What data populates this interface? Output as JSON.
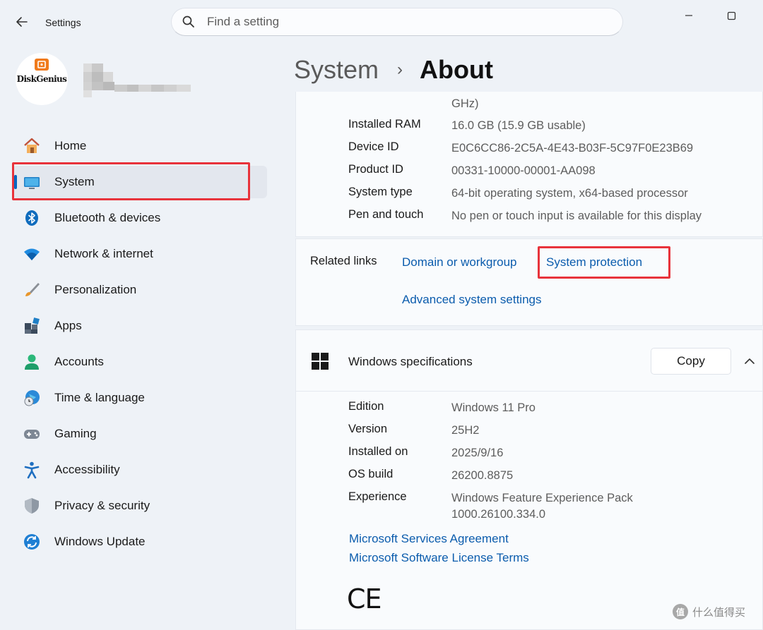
{
  "window": {
    "title": "Settings"
  },
  "search": {
    "placeholder": "Find a setting"
  },
  "profile": {
    "avatar_text": "DiskGenius"
  },
  "sidebar": {
    "items": [
      {
        "label": "Home"
      },
      {
        "label": "System"
      },
      {
        "label": "Bluetooth & devices"
      },
      {
        "label": "Network & internet"
      },
      {
        "label": "Personalization"
      },
      {
        "label": "Apps"
      },
      {
        "label": "Accounts"
      },
      {
        "label": "Time & language"
      },
      {
        "label": "Gaming"
      },
      {
        "label": "Accessibility"
      },
      {
        "label": "Privacy & security"
      },
      {
        "label": "Windows Update"
      }
    ]
  },
  "breadcrumb": {
    "parent": "System",
    "separator": "›",
    "current": "About"
  },
  "device_specs": {
    "rows": [
      {
        "key": "",
        "value": "GHz)"
      },
      {
        "key": "Installed RAM",
        "value": "16.0 GB (15.9 GB usable)"
      },
      {
        "key": "Device ID",
        "value": "E0C6CC86-2C5A-4E43-B03F-5C97F0E23B69"
      },
      {
        "key": "Product ID",
        "value": "00331-10000-00001-AA098"
      },
      {
        "key": "System type",
        "value": "64-bit operating system, x64-based processor"
      },
      {
        "key": "Pen and touch",
        "value": "No pen or touch input is available for this display"
      }
    ]
  },
  "related_links": {
    "label": "Related links",
    "links": [
      {
        "label": "Domain or workgroup"
      },
      {
        "label": "System protection"
      },
      {
        "label": "Advanced system settings"
      }
    ]
  },
  "windows_specs": {
    "title": "Windows specifications",
    "copy_label": "Copy",
    "rows": [
      {
        "key": "Edition",
        "value": "Windows 11 Pro"
      },
      {
        "key": "Version",
        "value": "25H2"
      },
      {
        "key": "Installed on",
        "value": "2025/9/16"
      },
      {
        "key": "OS build",
        "value": "26200.8875"
      },
      {
        "key": "Experience",
        "value": "Windows Feature Experience Pack",
        "value2": "1000.26100.334.0"
      }
    ],
    "links": [
      {
        "label": "Microsoft Services Agreement"
      },
      {
        "label": "Microsoft Software License Terms"
      }
    ],
    "ce_mark": "CE"
  },
  "watermark": {
    "icon_text": "值",
    "text": "什么值得买"
  },
  "colors": {
    "accent": "#0067c0",
    "link": "#0b5cad",
    "highlight": "#e8333b",
    "background": "#eef2f7"
  }
}
